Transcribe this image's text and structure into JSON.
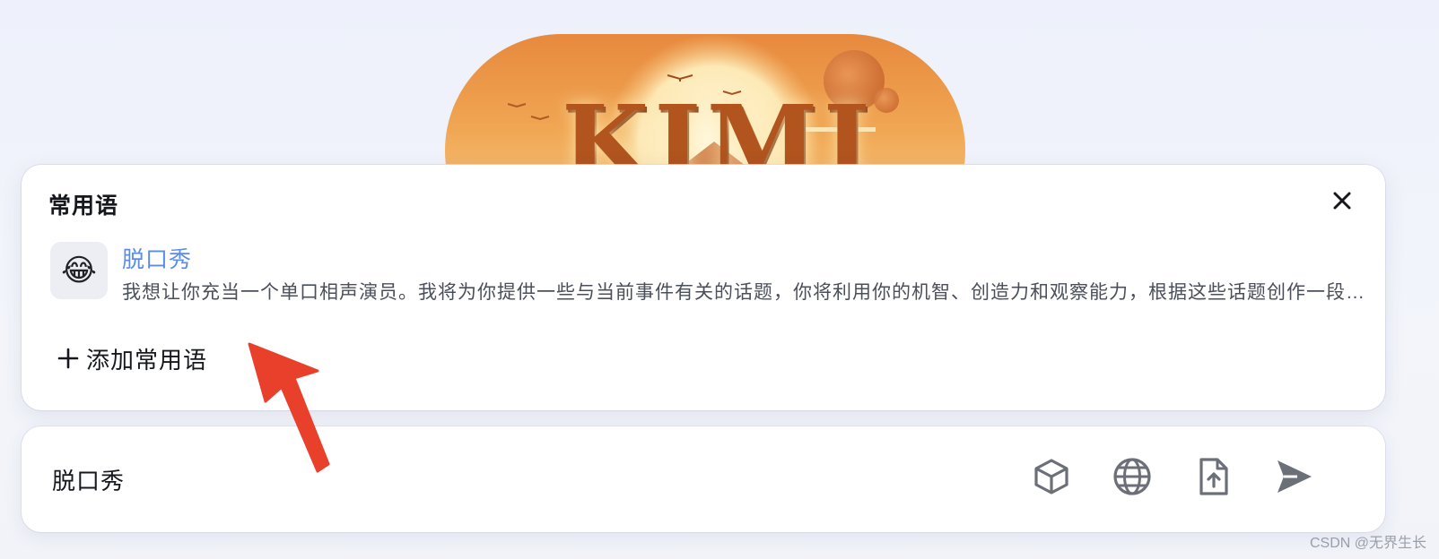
{
  "banner": {
    "word": "KIMI"
  },
  "phrases_panel": {
    "title": "常用语",
    "items": [
      {
        "emoji": "😂",
        "title": "脱口秀",
        "description": "我想让你充当一个单口相声演员。我将为你提供一些与当前事件有关的话题，你将利用你的机智、创造力和观察能力，根据这些话题创作一段节目。"
      }
    ],
    "add_label": "添加常用语"
  },
  "input_bar": {
    "value": "脱口秀",
    "tools": [
      "cube-icon",
      "globe-icon",
      "file-upload-icon",
      "send-icon"
    ]
  },
  "watermark": "CSDN @无界生长",
  "colors": {
    "accent_blue": "#5c8ce6",
    "annotation_red": "#e8402a",
    "icon_gray": "#6b6f78"
  }
}
